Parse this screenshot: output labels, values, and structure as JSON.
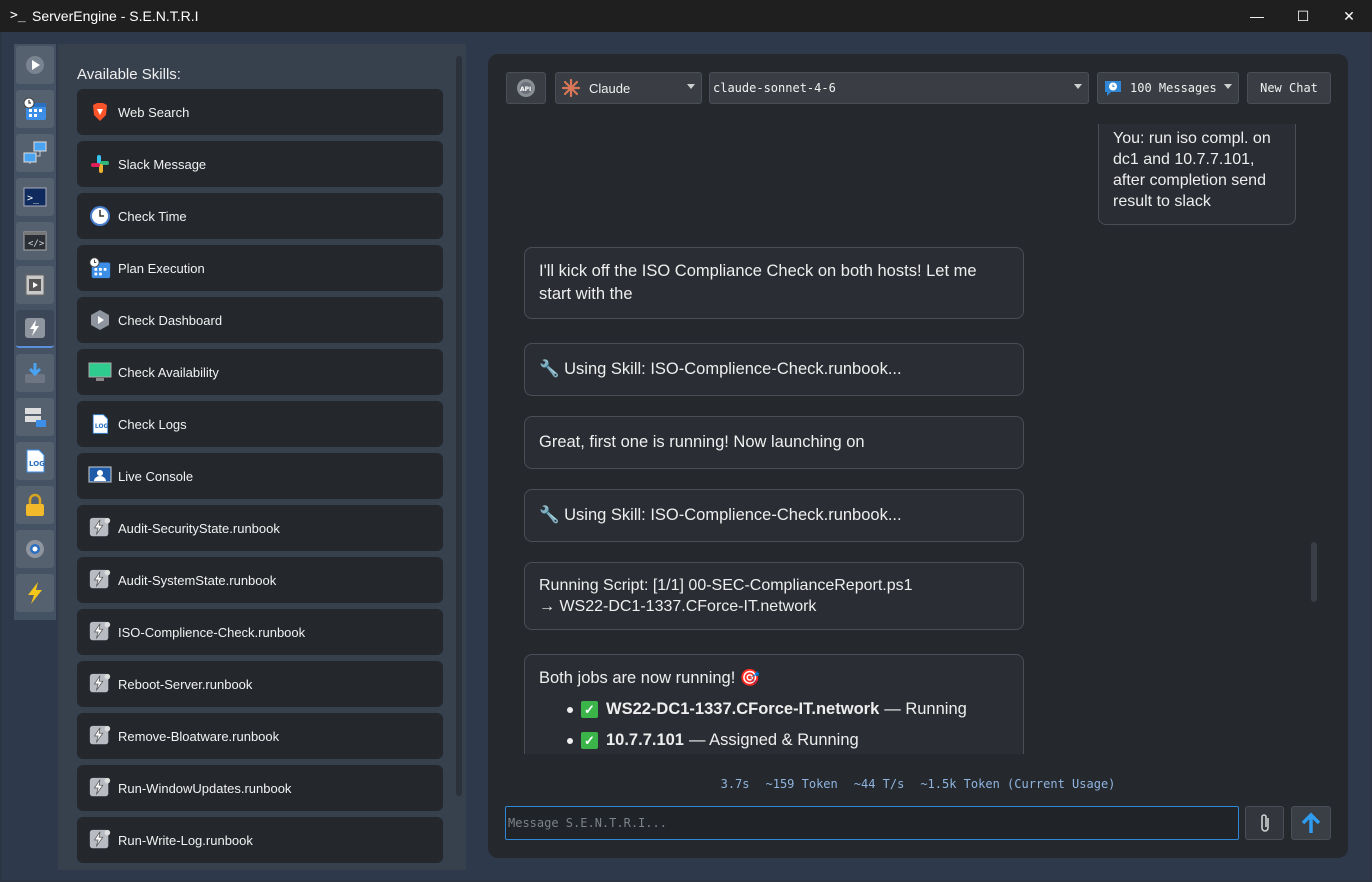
{
  "window": {
    "title": "ServerEngine - S.E.N.T.R.I",
    "minimize": "—",
    "maximize": "☐",
    "close": "✕"
  },
  "rail": {
    "items": [
      "play-icon",
      "calendar-clock-icon",
      "network-icon",
      "powershell-icon",
      "code-window-icon",
      "media-icon",
      "runbook-icon",
      "download-icon",
      "servers-icon",
      "log-icon",
      "lock-icon",
      "gear-icon",
      "lightning-icon"
    ],
    "active_index": 6
  },
  "skills": {
    "title": "Available Skills:",
    "items": [
      {
        "label": "Web Search",
        "icon": "brave-lion-icon"
      },
      {
        "label": "Slack Message",
        "icon": "slack-icon"
      },
      {
        "label": "Check Time",
        "icon": "clock-icon"
      },
      {
        "label": "Plan Execution",
        "icon": "calendar-clock-icon"
      },
      {
        "label": "Check Dashboard",
        "icon": "dashboard-icon"
      },
      {
        "label": "Check Availability",
        "icon": "monitor-icon"
      },
      {
        "label": "Check Logs",
        "icon": "log-icon"
      },
      {
        "label": "Live Console",
        "icon": "console-user-icon"
      },
      {
        "label": "Audit-SecurityState.runbook",
        "icon": "runbook-icon"
      },
      {
        "label": "Audit-SystemState.runbook",
        "icon": "runbook-icon"
      },
      {
        "label": "ISO-Complience-Check.runbook",
        "icon": "runbook-icon"
      },
      {
        "label": "Reboot-Server.runbook",
        "icon": "runbook-icon"
      },
      {
        "label": "Remove-Bloatware.runbook",
        "icon": "runbook-icon"
      },
      {
        "label": "Run-WindowUpdates.runbook",
        "icon": "runbook-icon"
      },
      {
        "label": "Run-Write-Log.runbook",
        "icon": "runbook-icon"
      }
    ]
  },
  "toolbar": {
    "api_label": "API",
    "provider": "Claude",
    "model": "claude-sonnet-4-6",
    "messages": "100 Messages",
    "new_chat": "New Chat"
  },
  "messages": {
    "user": "You: run iso compl. on dc1 and 10.7.7.101, after completion send result to slack",
    "m1": "I'll kick off the ISO Compliance Check on both hosts! Let me start with the",
    "m2": "🔧 Using Skill: ISO-Complience-Check.runbook...",
    "m3": "Great, first one is running! Now launching on",
    "m4": "🔧 Using Skill: ISO-Complience-Check.runbook...",
    "m5_line1": "Running Script: [1/1] 00-SEC-ComplianceReport.ps1",
    "m5_line2": "→ WS22-DC1-1337.CForce-IT.network",
    "m6_intro": "Both jobs are now running! 🎯",
    "m6_items": [
      {
        "host": "WS22-DC1-1337.CForce-IT.network",
        "status": "— Running"
      },
      {
        "host": "10.7.7.101",
        "status": "— Assigned & Running"
      }
    ]
  },
  "stats": {
    "time": "3.7s",
    "tokens": "~159 Token",
    "rate": "~44 T/s",
    "usage": "~1.5k Token (Current Usage)"
  },
  "input": {
    "placeholder": "Message S.E.N.T.R.I..."
  }
}
